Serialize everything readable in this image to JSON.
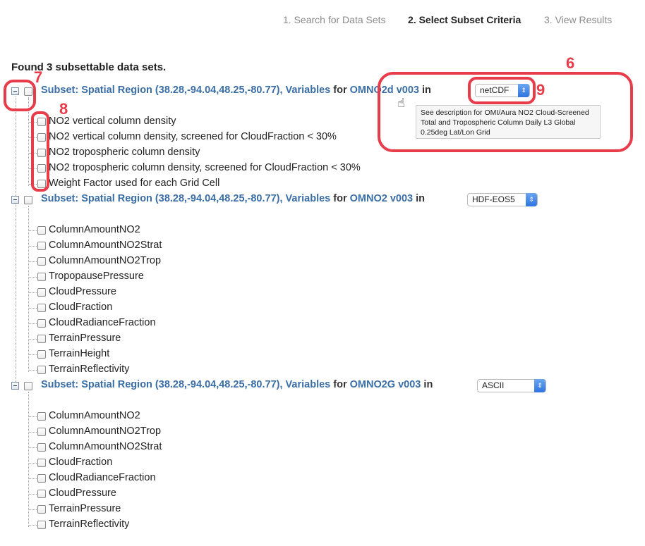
{
  "steps": [
    {
      "label": "1. Search for Data Sets"
    },
    {
      "label": "2. Select Subset Criteria"
    },
    {
      "label": "3. View Results"
    }
  ],
  "found_text": "Found 3 subsettable data sets.",
  "datasets": [
    {
      "title_prefix": "Subset: Spatial Region (38.28,-94.04,48.25,-80.77), Variables",
      "for": "for",
      "name": "OMNO2d v003",
      "in": "in",
      "format": "netCDF",
      "variables": [
        "NO2 vertical column density",
        "NO2 vertical column density, screened for CloudFraction < 30%",
        "NO2 tropospheric column density",
        "NO2 tropospheric column density, screened for CloudFraction < 30%",
        "Weight Factor used for each Grid Cell"
      ]
    },
    {
      "title_prefix": "Subset: Spatial Region (38.28,-94.04,48.25,-80.77), Variables",
      "for": "for",
      "name": "OMNO2 v003",
      "in": "in",
      "format": "HDF-EOS5",
      "variables": [
        "ColumnAmountNO2",
        "ColumnAmountNO2Strat",
        "ColumnAmountNO2Trop",
        "TropopausePressure",
        "CloudPressure",
        "CloudFraction",
        "CloudRadianceFraction",
        "TerrainPressure",
        "TerrainHeight",
        "TerrainReflectivity"
      ]
    },
    {
      "title_prefix": "Subset: Spatial Region (38.28,-94.04,48.25,-80.77), Variables",
      "for": "for",
      "name": "OMNO2G v003",
      "in": "in",
      "format": "ASCII",
      "variables": [
        "ColumnAmountNO2",
        "ColumnAmountNO2Trop",
        "ColumnAmountNO2Strat",
        "CloudFraction",
        "CloudRadianceFraction",
        "CloudPressure",
        "TerrainPressure",
        "TerrainReflectivity"
      ]
    }
  ],
  "tooltip": "See description for OMI/Aura NO2 Cloud-Screened Total and Tropospheric Column Daily L3 Global 0.25deg Lat/Lon Grid",
  "annotations": {
    "n6": "6",
    "n7": "7",
    "n8": "8",
    "n9": "9",
    "color": "#e83c4a"
  },
  "colors": {
    "link": "#3a6ea5",
    "select_accent": "#2f74e0"
  }
}
